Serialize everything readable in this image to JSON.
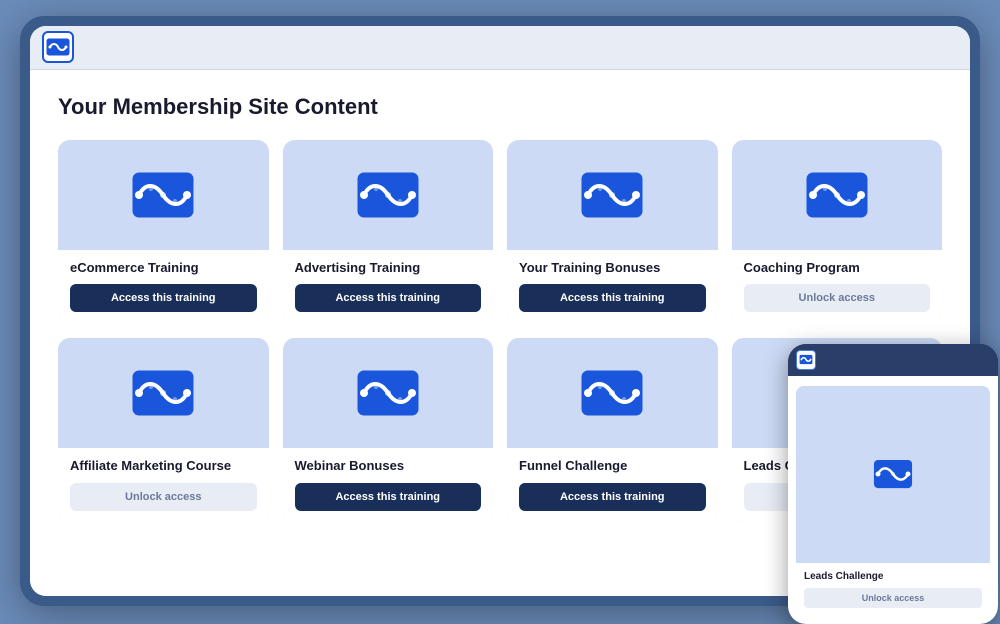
{
  "app": {
    "title": "Your Membership Site Content"
  },
  "cards": [
    {
      "id": "ecommerce-training",
      "title": "eCommerce Training",
      "button_label": "Access this training",
      "button_type": "access"
    },
    {
      "id": "advertising-training",
      "title": "Advertising Training",
      "button_label": "Access this training",
      "button_type": "access"
    },
    {
      "id": "your-training-bonuses",
      "title": "Your Training Bonuses",
      "button_label": "Access this training",
      "button_type": "access"
    },
    {
      "id": "coaching-program",
      "title": "Coaching Program",
      "button_label": "Unlock access",
      "button_type": "unlock"
    },
    {
      "id": "affiliate-marketing-course",
      "title": "Affiliate Marketing Course",
      "button_label": "Unlock access",
      "button_type": "unlock"
    },
    {
      "id": "webinar-bonuses",
      "title": "Webinar Bonuses",
      "button_label": "Access this training",
      "button_type": "access"
    },
    {
      "id": "funnel-challenge",
      "title": "Funnel Challenge",
      "button_label": "Access this training",
      "button_type": "access"
    },
    {
      "id": "leads-challenge",
      "title": "Leads Challenge",
      "button_label": "Unlock access",
      "button_type": "unlock"
    }
  ],
  "tablet_overlay": {
    "card_title": "Leads Challenge",
    "button_label": "Unlock access"
  },
  "colors": {
    "accent_blue": "#1a56db",
    "dark_navy": "#1a2e5a",
    "card_bg": "#dce8f8",
    "card_img_bg": "#ccdaf5",
    "unlock_bg": "#e8edf5",
    "unlock_text": "#6b7a99"
  }
}
